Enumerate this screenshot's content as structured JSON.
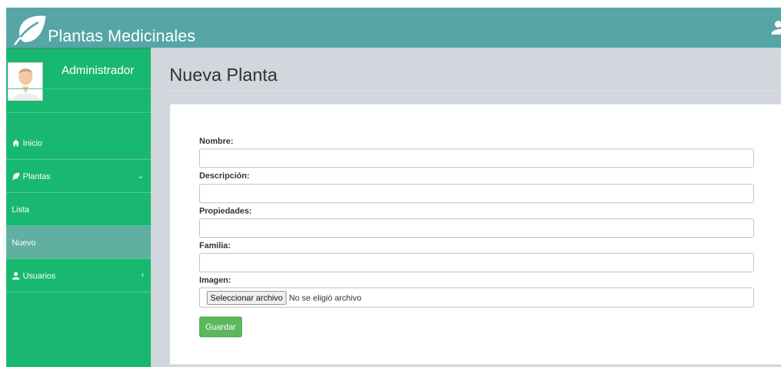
{
  "header": {
    "brand_title": "Plantas Medicinales",
    "brand_icon": "leaf-icon",
    "user_icon": "user-icon",
    "brand_color": "#55a6a5"
  },
  "sidebar": {
    "profile_name": "Administrador",
    "color": "#19b871",
    "active_color": "#5fb0a0",
    "items": [
      {
        "label": "Inicio",
        "icon": "home-icon"
      },
      {
        "label": "Plantas",
        "icon": "leaf-icon",
        "chevron": "⌄"
      },
      {
        "label": "Lista"
      },
      {
        "label": "Nuevo",
        "active": true
      },
      {
        "label": "Usuarios",
        "icon": "user-icon",
        "chevron": "‹"
      }
    ]
  },
  "main": {
    "page_title": "Nueva Planta",
    "form": {
      "nombre_label": "Nombre:",
      "nombre_value": "",
      "descripcion_label": "Descripción:",
      "descripcion_value": "",
      "propiedades_label": "Propiedades:",
      "propiedades_value": "",
      "familia_label": "Familia:",
      "familia_value": "",
      "imagen_label": "Imagen:",
      "file_button_label": "Seleccionar archivo",
      "file_status": "No se eligió archivo",
      "save_label": "Guardar",
      "save_color": "#5cb85c"
    }
  }
}
